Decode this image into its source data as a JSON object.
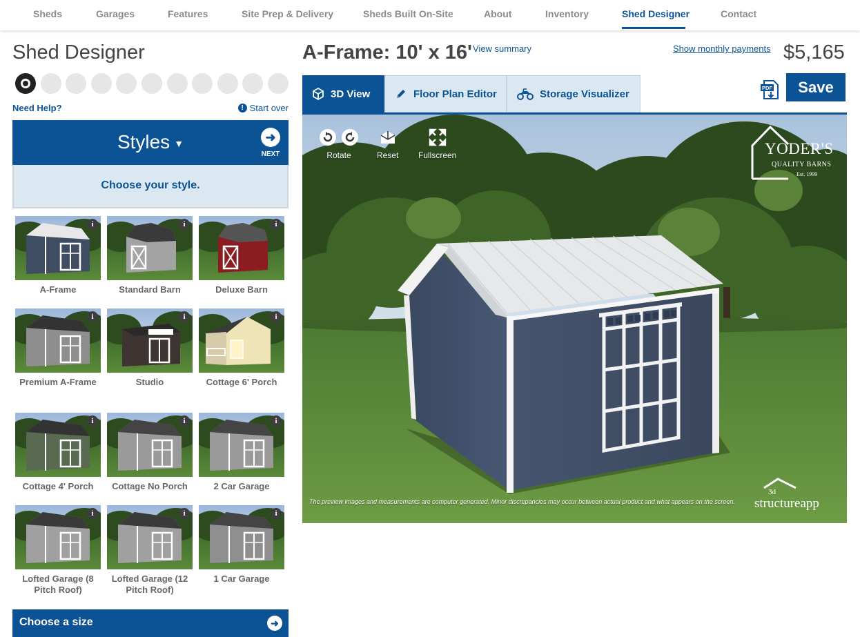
{
  "nav": {
    "items": [
      "Sheds",
      "Garages",
      "Features",
      "Site Prep & Delivery",
      "Sheds Built On-Site",
      "About",
      "Inventory",
      "Shed Designer",
      "Contact"
    ],
    "active": "Shed Designer"
  },
  "designer": {
    "title": "Shed Designer",
    "step_count": 11,
    "current_step": 1,
    "need_help": "Need Help?",
    "start_over": "Start over",
    "styles_label": "Styles",
    "next_label": "NEXT",
    "choose_style": "Choose your style.",
    "styles": [
      {
        "name": "A-Frame",
        "roof": "gable",
        "color": "#3f4d63",
        "trim": "#ffffff",
        "roof_color": "#e8e8e8"
      },
      {
        "name": "Standard Barn",
        "roof": "barn",
        "color": "#a3a3a3",
        "trim": "#ffffff",
        "roof_color": "#3a3a3a"
      },
      {
        "name": "Deluxe Barn",
        "roof": "barn",
        "color": "#8b1c22",
        "trim": "#ffffff",
        "roof_color": "#555555"
      },
      {
        "name": "Premium A-Frame",
        "roof": "gable",
        "color": "#8e8e8e",
        "trim": "#ffffff",
        "roof_color": "#333333"
      },
      {
        "name": "Studio",
        "roof": "studio",
        "color": "#3e3532",
        "trim": "#ffffff",
        "roof_color": "#2a2a2a"
      },
      {
        "name": "Cottage 6' Porch",
        "roof": "porch",
        "color": "#efe3b8",
        "trim": "#ffffff",
        "roof_color": "#3a3a3a"
      },
      {
        "name": "Cottage 4' Porch",
        "roof": "gable",
        "color": "#5a6a50",
        "trim": "#ffffff",
        "roof_color": "#333333"
      },
      {
        "name": "Cottage No Porch",
        "roof": "gable",
        "color": "#9a9a9a",
        "trim": "#ffffff",
        "roof_color": "#444444"
      },
      {
        "name": "2 Car Garage",
        "roof": "gable",
        "color": "#9a9a9a",
        "trim": "#ffffff",
        "roof_color": "#444444"
      },
      {
        "name": "Lofted Garage (8 Pitch Roof)",
        "roof": "gable",
        "color": "#a0a0a0",
        "trim": "#ffffff",
        "roof_color": "#3a3a3a"
      },
      {
        "name": "Lofted Garage (12 Pitch Roof)",
        "roof": "gable",
        "color": "#a0a0a0",
        "trim": "#ffffff",
        "roof_color": "#3a3a3a"
      },
      {
        "name": "1 Car Garage",
        "roof": "gable",
        "color": "#8f8f8f",
        "trim": "#ffffff",
        "roof_color": "#444444"
      }
    ],
    "info_glyph": "i",
    "choose_size": "Choose a size"
  },
  "summary": {
    "model_title": "A-Frame: 10' x 16'",
    "view_summary": "View summary",
    "monthly_payments": "Show monthly payments",
    "price": "$5,165",
    "save_label": "Save",
    "pdf_label": "PDF"
  },
  "tabs": [
    {
      "label": "3D View",
      "icon": "cube-icon",
      "active": true
    },
    {
      "label": "Floor Plan Editor",
      "icon": "pencil-icon",
      "active": false
    },
    {
      "label": "Storage Visualizer",
      "icon": "atv-icon",
      "active": false
    }
  ],
  "viewer": {
    "controls": {
      "rotate": "Rotate",
      "reset": "Reset",
      "fullscreen": "Fullscreen"
    },
    "brand": {
      "name": "YODER'S",
      "sub": "QUALITY BARNS",
      "est": "Est. 1999"
    },
    "disclaimer": "The preview images and measurements are computer generated. Minor discrepancies may occur between actual product and what appears on the screen.",
    "app_logo_top": "3d",
    "app_logo": "structureapp"
  },
  "colors": {
    "brand_blue": "#0b5394",
    "tab_inactive_bg": "#dbe7f1",
    "shed_body": "#3f4d63",
    "shed_trim": "#ffffff",
    "shed_roof": "#e6e8ea"
  }
}
